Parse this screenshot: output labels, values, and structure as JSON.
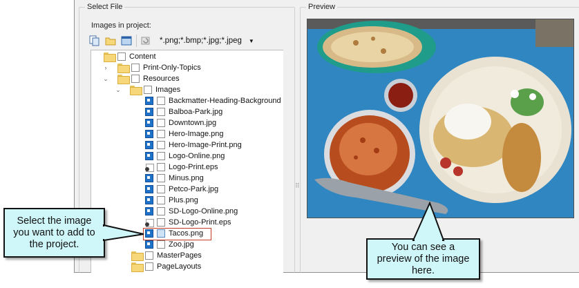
{
  "select_file": {
    "title": "Select File",
    "images_label": "Images in project:",
    "filter": "*.png;*.bmp;*.jpg;*.jpeg",
    "toolbar_icons": [
      "copy-icon",
      "open-folder-icon",
      "window-icon",
      "refresh-icon"
    ],
    "tree": {
      "content": "Content",
      "print_only": "Print-Only-Topics",
      "resources": "Resources",
      "images": "Images",
      "files": [
        {
          "label": "Backmatter-Heading-Background",
          "icon": "image-icon"
        },
        {
          "label": "Balboa-Park.jpg",
          "icon": "image-icon"
        },
        {
          "label": "Downtown.jpg",
          "icon": "image-icon"
        },
        {
          "label": "Hero-Image.png",
          "icon": "image-icon"
        },
        {
          "label": "Hero-Image-Print.png",
          "icon": "image-icon"
        },
        {
          "label": "Logo-Online.png",
          "icon": "image-icon"
        },
        {
          "label": "Logo-Print.eps",
          "icon": "eps-icon"
        },
        {
          "label": "Minus.png",
          "icon": "image-icon"
        },
        {
          "label": "Petco-Park.jpg",
          "icon": "image-icon"
        },
        {
          "label": "Plus.png",
          "icon": "image-icon"
        },
        {
          "label": "SD-Logo-Online.png",
          "icon": "image-icon"
        },
        {
          "label": "SD-Logo-Print.eps",
          "icon": "eps-icon"
        },
        {
          "label": "Tacos.png",
          "icon": "image-icon",
          "selected": true
        },
        {
          "label": "Zoo.jpg",
          "icon": "image-icon"
        }
      ],
      "master_pages": "MasterPages",
      "page_layouts": "PageLayouts"
    }
  },
  "preview": {
    "title": "Preview"
  },
  "callouts": {
    "left": "Select the image you want to add to the project.",
    "right": "You can see a preview of the image here."
  },
  "colors": {
    "callout_fill": "#cff6f8",
    "highlight_border": "#c33b22",
    "tray_blue": "#3a8fc4"
  }
}
